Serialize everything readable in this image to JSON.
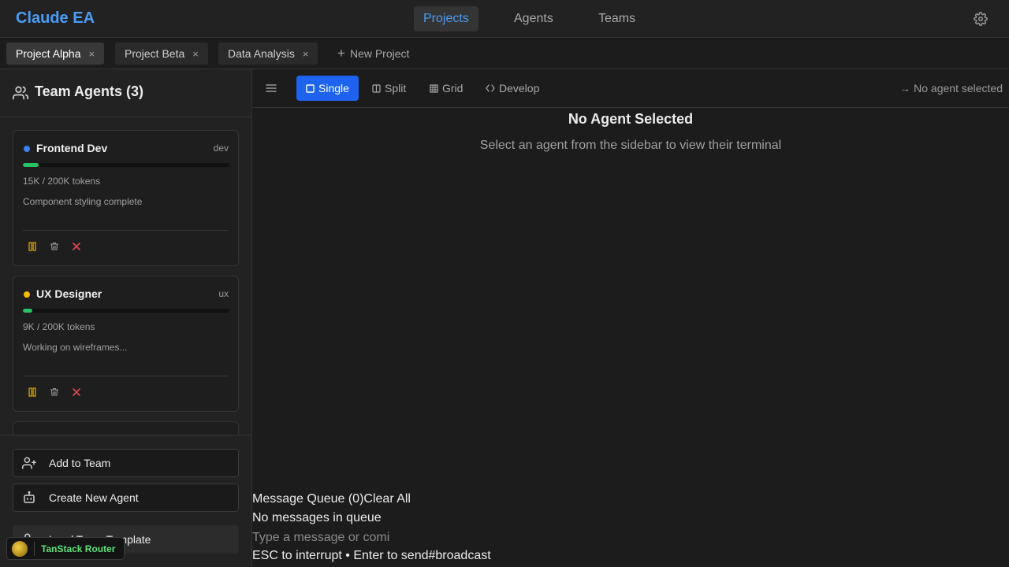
{
  "app": {
    "name": "Claude EA"
  },
  "topnav": [
    {
      "label": "Projects",
      "active": true
    },
    {
      "label": "Agents",
      "active": false
    },
    {
      "label": "Teams",
      "active": false
    }
  ],
  "tabs": [
    {
      "label": "Project Alpha",
      "active": true,
      "close": "×"
    },
    {
      "label": "Project Beta",
      "active": false,
      "close": "×"
    },
    {
      "label": "Data Analysis",
      "active": false,
      "close": "×"
    }
  ],
  "new_project_label": "New Project",
  "sidebar": {
    "title": "Team Agents (3)",
    "agents": [
      {
        "name": "Frontend Dev",
        "role": "dev",
        "dot_color": "#3b82f6",
        "tokens": "15K / 200K tokens",
        "token_fraction": 0.075,
        "status": "Component styling complete"
      },
      {
        "name": "UX Designer",
        "role": "ux",
        "dot_color": "#f5b800",
        "tokens": "9K / 200K tokens",
        "token_fraction": 0.045,
        "status": "Working on wireframes..."
      }
    ],
    "buttons": {
      "add_to_team": "Add to Team",
      "create_agent": "Create New Agent",
      "load_template": "Load Team Template"
    }
  },
  "view_modes": [
    {
      "label": "Single",
      "active": true
    },
    {
      "label": "Split",
      "active": false
    },
    {
      "label": "Grid",
      "active": false
    },
    {
      "label": "Develop",
      "active": false
    }
  ],
  "agent_status": "No agent selected",
  "empty_state": {
    "title": "No Agent Selected",
    "subtitle": "Select an agent from the sidebar to view their terminal"
  },
  "queue": {
    "title": "Message Queue (0)",
    "clear_label": "Clear All",
    "empty": "No messages in queue",
    "placeholder": "Type a message or comi",
    "hint": "ESC to interrupt • Enter to send",
    "channel": "#broadcast"
  },
  "devtools": {
    "label": "TanStack Router"
  },
  "colors": {
    "accent": "#4a9cf5",
    "primary_button": "#1d63f0",
    "progress": "#27c267",
    "danger": "#e5484d",
    "pause": "#d9a200"
  }
}
